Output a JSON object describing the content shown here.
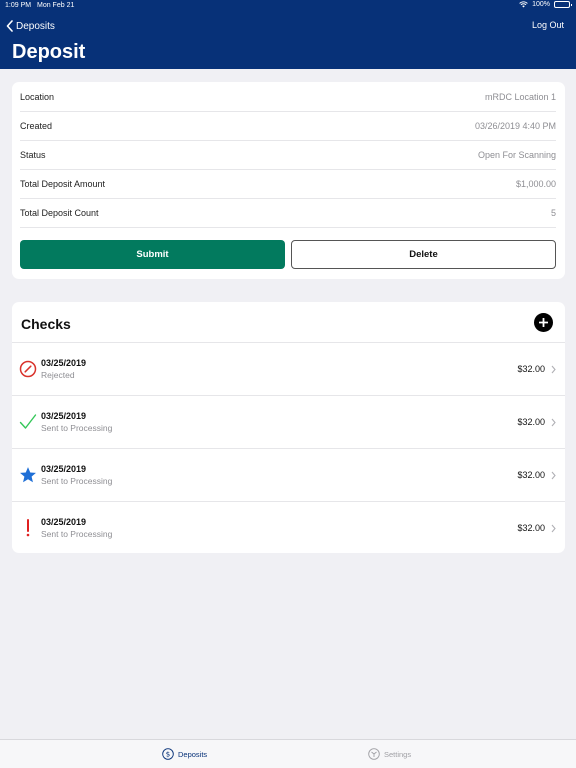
{
  "status_bar": {
    "time": "1:09 PM",
    "date": "Mon Feb 21",
    "battery": "100%"
  },
  "nav": {
    "back_label": "Deposits",
    "right_label": "Log Out",
    "title": "Deposit"
  },
  "details": [
    {
      "label": "Location",
      "value": "mRDC Location 1"
    },
    {
      "label": "Created",
      "value": "03/26/2019 4:40 PM"
    },
    {
      "label": "Status",
      "value": "Open For Scanning"
    },
    {
      "label": "Total Deposit Amount",
      "value": "$1,000.00"
    },
    {
      "label": "Total Deposit Count",
      "value": "5"
    }
  ],
  "actions": {
    "submit_label": "Submit",
    "delete_label": "Delete"
  },
  "checks": {
    "title": "Checks",
    "items": [
      {
        "date": "03/25/2019",
        "status": "Rejected",
        "amount": "$32.00",
        "icon": "rejected-icon"
      },
      {
        "date": "03/25/2019",
        "status": "Sent to Processing",
        "amount": "$32.00",
        "icon": "checkmark-icon"
      },
      {
        "date": "03/25/2019",
        "status": "Sent to Processing",
        "amount": "$32.00",
        "icon": "star-icon"
      },
      {
        "date": "03/25/2019",
        "status": "Sent to Processing",
        "amount": "$32.00",
        "icon": "exclamation-icon"
      }
    ]
  },
  "tabs": {
    "deposits_label": "Deposits",
    "settings_label": "Settings"
  },
  "colors": {
    "header": "#073178",
    "submit": "#027a5e",
    "rejected": "#d9322b",
    "processed": "#34c759",
    "star": "#1f6fd6",
    "warning": "#e02020"
  }
}
